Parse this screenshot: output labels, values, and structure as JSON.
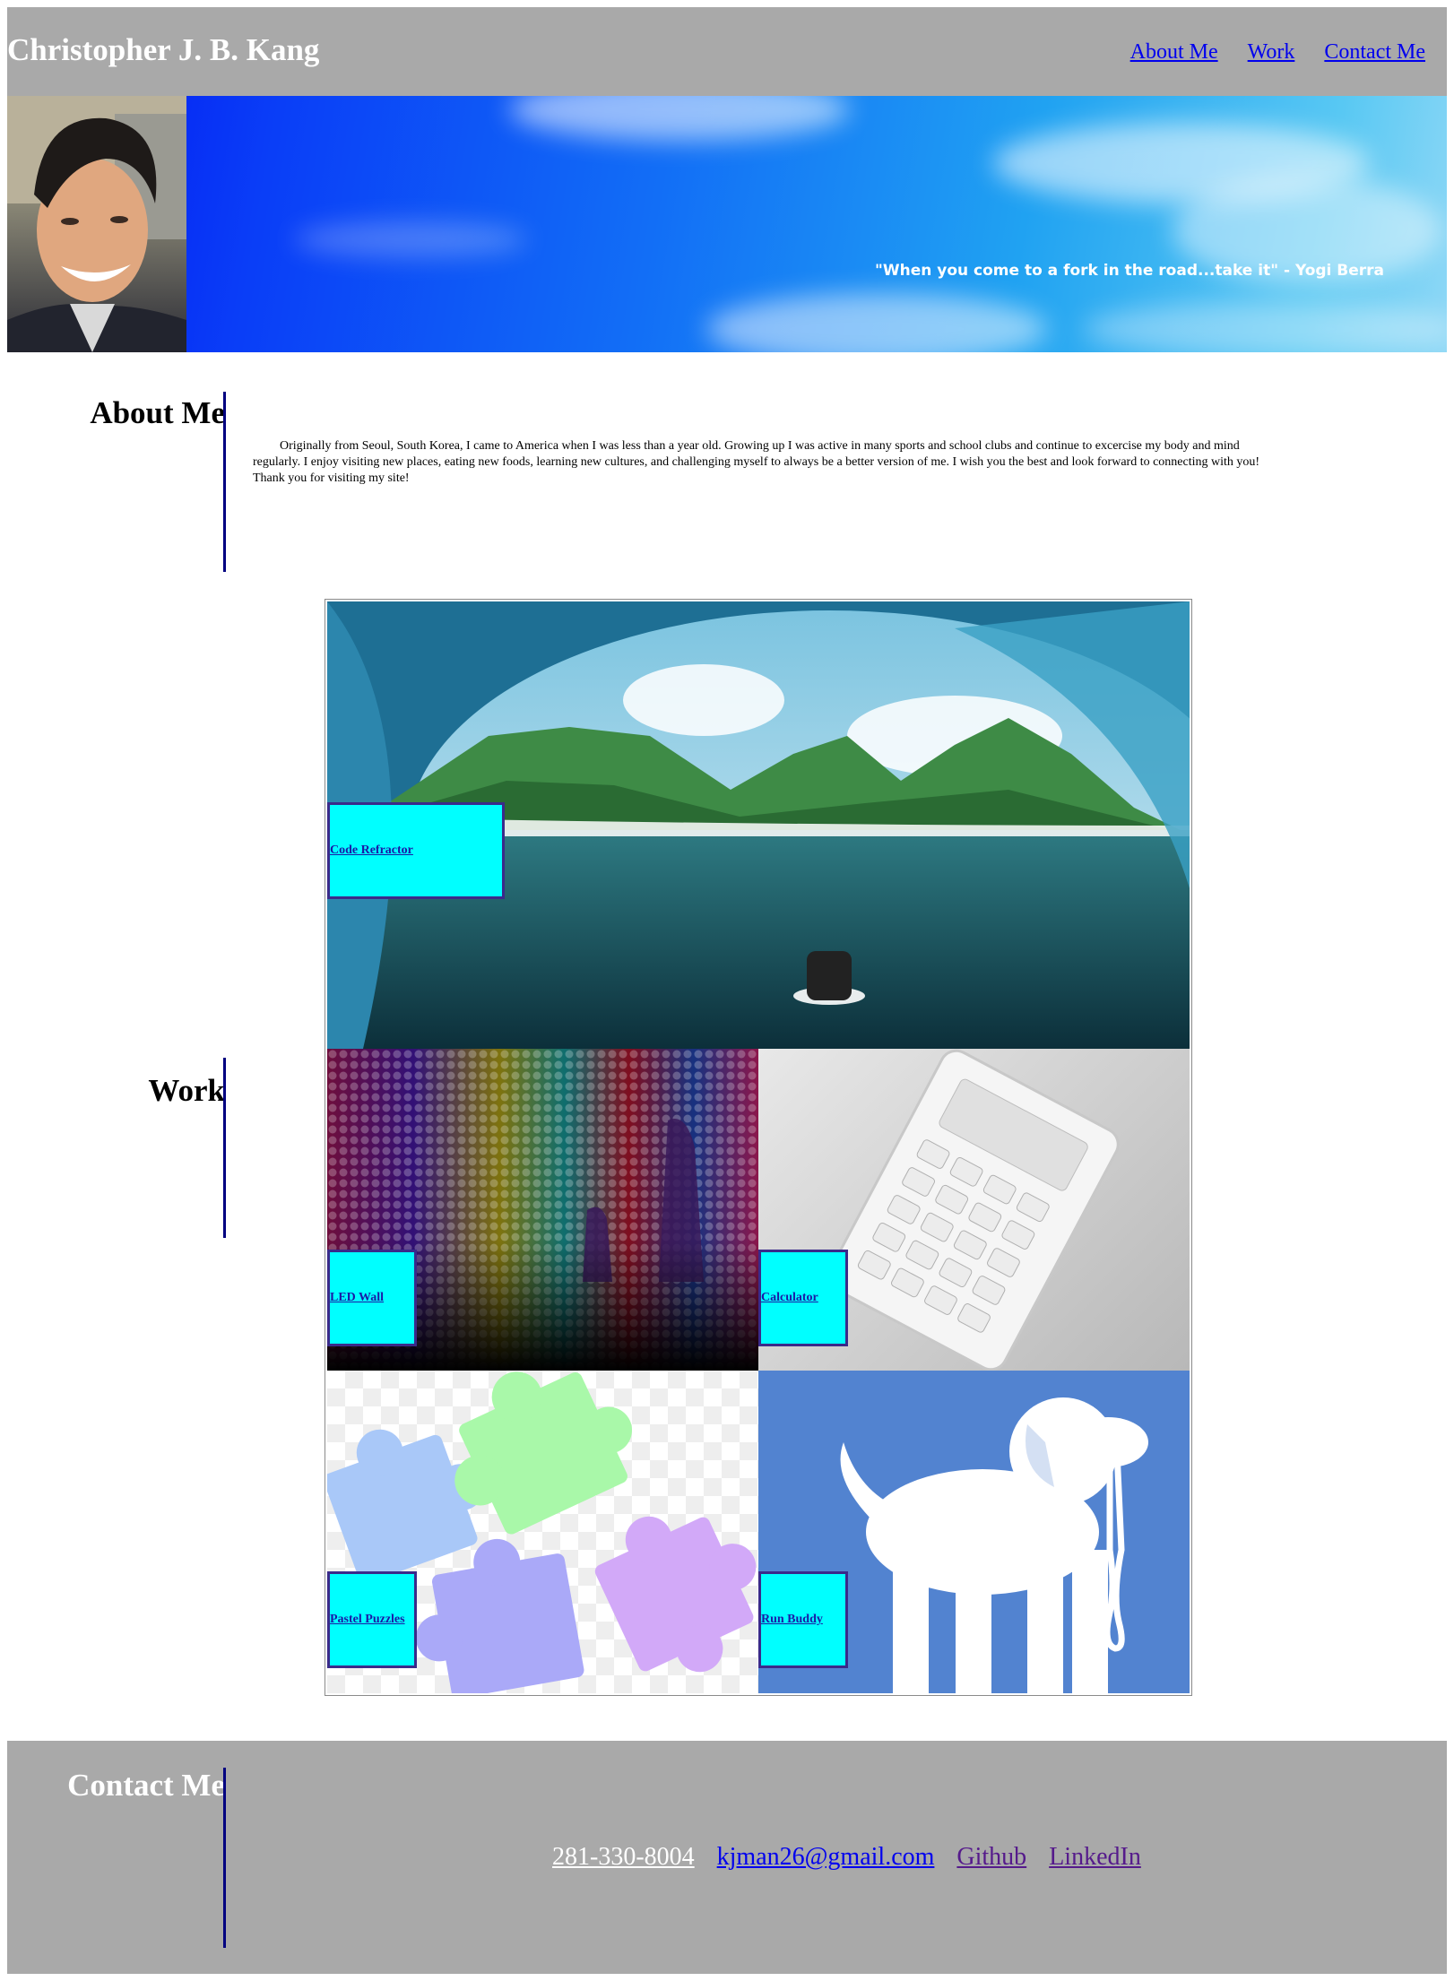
{
  "header": {
    "title": "Christopher J. B. Kang",
    "nav": [
      "About Me",
      "Work",
      "Contact Me"
    ]
  },
  "hero": {
    "quote": "\"When you come to a fork in the road...take it\" - Yogi Berra"
  },
  "about": {
    "title": "About Me",
    "text": "Originally from Seoul, South Korea, I came to America when I was less than a year old. Growing up I was active in many sports and school clubs and continue to excercise my body and mind regularly. I enjoy visiting new places, eating new foods, learning new cultures, and challenging myself to always be a better version of me. I wish you the best and look forward to connecting with you! Thank you for visiting my site!"
  },
  "work": {
    "title": "Work",
    "projects": [
      "Code Refractor",
      "LED Wall",
      "Calculator",
      "Pastel Puzzles",
      "Run Buddy"
    ]
  },
  "contact": {
    "title": "Contact Me",
    "phone": "281-330-8004",
    "email": "kjman26@gmail.com",
    "github": "Github",
    "linkedin": "LinkedIn"
  },
  "colors": {
    "header_bg": "#a9a9a9",
    "accent_bar": "#000080",
    "label_bg": "#00ffff"
  }
}
